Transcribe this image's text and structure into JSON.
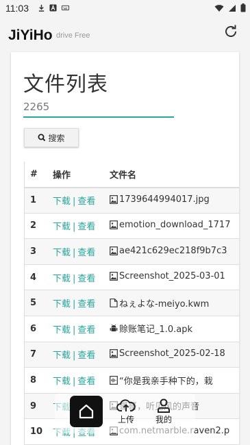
{
  "status": {
    "time": "11:03"
  },
  "app": {
    "title": "JiYiHo",
    "subtitle": "drive Free"
  },
  "page": {
    "title": "文件列表"
  },
  "search": {
    "value": "2265",
    "button_label": "搜索"
  },
  "table": {
    "headers": {
      "num": "#",
      "op": "操作",
      "name": "文件名"
    },
    "download_label": "下载",
    "separator": "|",
    "view_label": "查看",
    "rows": [
      {
        "num": "1",
        "icon": "image-file-icon",
        "name": "1739644994017.jpg"
      },
      {
        "num": "2",
        "icon": "image-file-icon",
        "name": "emotion_download_1717"
      },
      {
        "num": "3",
        "icon": "image-file-icon",
        "name": "ae421c629ec218f9b7c3"
      },
      {
        "num": "4",
        "icon": "image-file-icon",
        "name": "Screenshot_2025-03-01"
      },
      {
        "num": "5",
        "icon": "document-file-icon",
        "name": "ねぇよな-meiyo.kwm"
      },
      {
        "num": "6",
        "icon": "android-icon",
        "name": "赊账笔记_1.0.apk"
      },
      {
        "num": "7",
        "icon": "image-file-icon",
        "name": "Screenshot_2025-02-18"
      },
      {
        "num": "8",
        "icon": "audio-file-icon",
        "name": "“你是我亲手种下的，栽"
      },
      {
        "num": "9",
        "icon": "image-file-icon",
        "name": "哥哥，听见风的声音"
      },
      {
        "num": "10",
        "icon": "image-file-icon",
        "name": "com.netmarble.raven2.p"
      }
    ]
  },
  "nav": {
    "upload_label": "上传",
    "mine_label": "我的"
  },
  "colors": {
    "accent": "#26a69a",
    "nav_home_bg": "#111111"
  }
}
